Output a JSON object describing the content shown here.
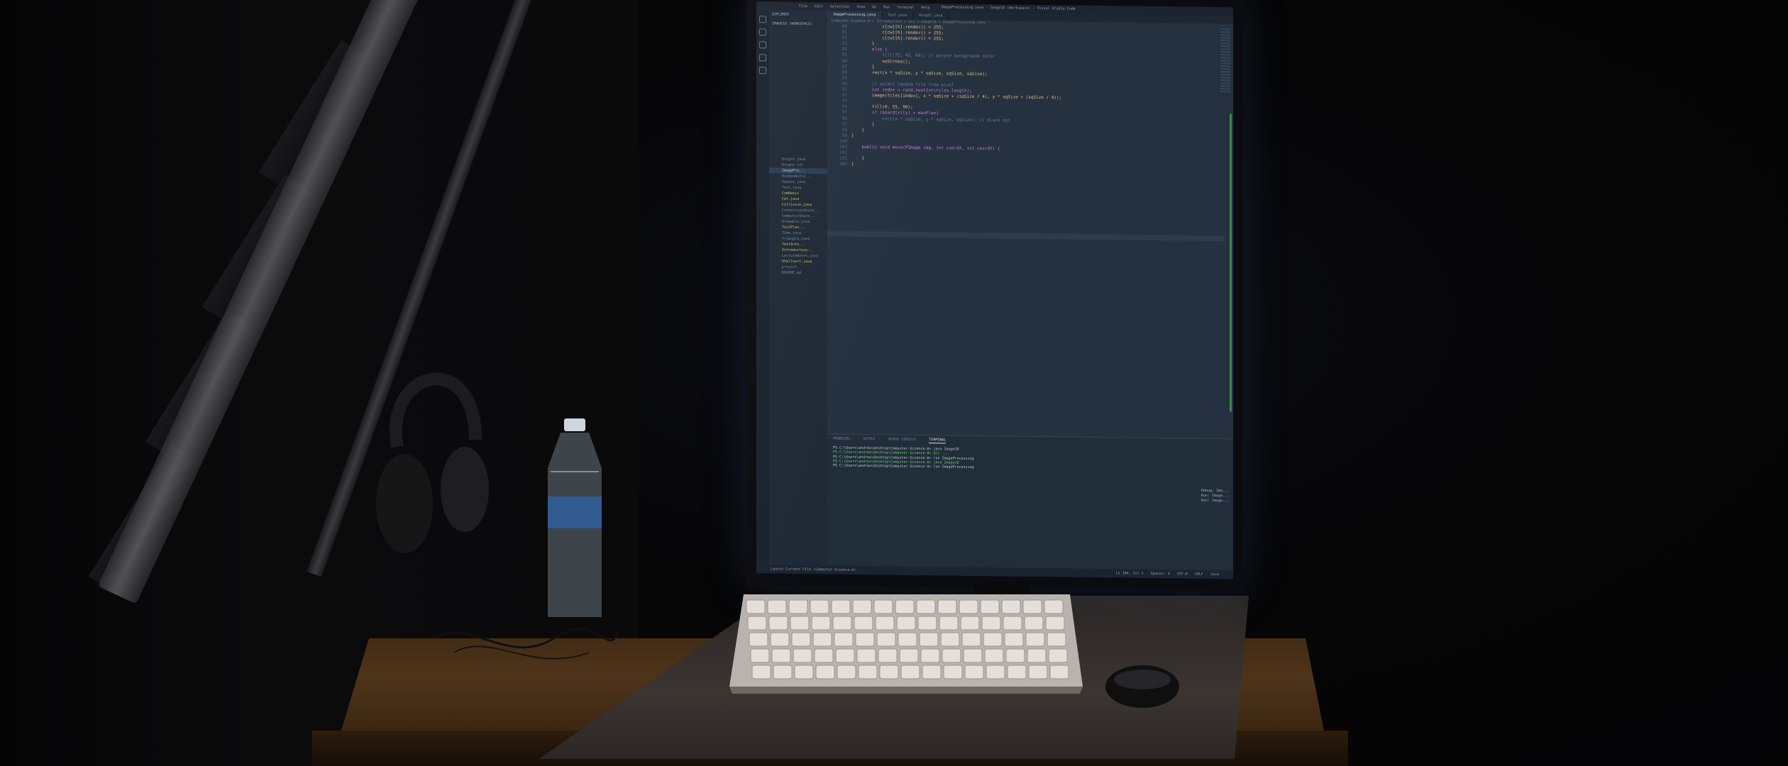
{
  "vscode": {
    "window_title": "ImageProcessing.java - Image1D (Workspace) - Visual Studio Code",
    "menu": [
      "File",
      "Edit",
      "Selection",
      "View",
      "Go",
      "Run",
      "Terminal",
      "Help"
    ],
    "tabs": [
      {
        "label": "ImageProcessing.java",
        "active": true
      },
      {
        "label": "Test.java",
        "active": false
      },
      {
        "label": "Knight.java",
        "active": false
      }
    ],
    "breadcrumb": "Computer-Science-A > Introduction > src > image1d > ImageProcessing.java",
    "sidebar_title": "EXPLORER",
    "sidebar_section": "IMAGE1D (WORKSPACE)",
    "tree": [
      {
        "label": "Knight.java",
        "hi": false,
        "sel": false
      },
      {
        "label": "Knight.txt",
        "hi": false,
        "sel": false
      },
      {
        "label": "ImagePro...",
        "hi": false,
        "sel": true
      },
      {
        "label": "HiddenWorld...",
        "hi": false,
        "sel": false
      },
      {
        "label": "Square.java",
        "hi": false,
        "sel": false
      },
      {
        "label": "Test.java",
        "hi": false,
        "sel": false
      },
      {
        "label": "ComBasic",
        "hi": true,
        "sel": false
      },
      {
        "label": "Cat.java",
        "hi": true,
        "sel": false
      },
      {
        "label": "Collision.java",
        "hi": true,
        "sel": false
      },
      {
        "label": "ConnectionShare...",
        "hi": false,
        "sel": false
      },
      {
        "label": "ComputerShare...",
        "hi": false,
        "sel": false
      },
      {
        "label": "Drawable.java",
        "hi": false,
        "sel": false
      },
      {
        "label": "TestPlan...",
        "hi": true,
        "sel": false
      },
      {
        "label": "Time.java",
        "hi": false,
        "sel": false
      },
      {
        "label": "Triangle.java",
        "hi": false,
        "sel": false
      },
      {
        "label": "TestInfo...",
        "hi": true,
        "sel": false
      },
      {
        "label": "Introduction...",
        "hi": true,
        "sel": false
      },
      {
        "label": "LectureNotes.java",
        "hi": false,
        "sel": false
      },
      {
        "label": "Shellsort.java",
        "hi": true,
        "sel": false
      },
      {
        "label": "project",
        "hi": false,
        "sel": false
      },
      {
        "label": "README.md",
        "hi": false,
        "sel": false
      }
    ],
    "line_numbers": [
      "80",
      "81",
      "82",
      "83",
      "84",
      "85",
      "86",
      "87",
      "88",
      "89",
      "90",
      "91",
      "92",
      "93",
      "94",
      "95",
      "96",
      "97",
      "98",
      "99",
      "100",
      "101",
      "102",
      "103",
      "104"
    ],
    "code_lines": [
      "            c[cw][h].render() = 255;",
      "            c[cw][h].render() = 255;",
      "            c[cw][h].render() = 255;",
      "        }",
      "        else {",
      "            fill(75, 45, 60); // purple background color",
      "            noStroke();",
      "        }",
      "        rect(x * sqSize, y * sqSize, sqSize, sqSize);",
      "",
      "        // select random tile from pixel",
      "        int index = rand.nextInt(tiles.length);",
      "        image(tiles[index], x * sqSize + (sqSize / 4), y * sqSize + (sqSize / 4));",
      "",
      "        fill(0, 55, 90);",
      "        if (board[x][y] > maxPlan)",
      "            rect(x * sqSize, y * sqSize, sqSize); // black out",
      "        }",
      "    }",
      "}",
      "",
      "    public void move(PImage img, int coordX, int coordY) {",
      "",
      "    }",
      "}"
    ],
    "panel_tabs": [
      {
        "label": "PROBLEMS",
        "active": false
      },
      {
        "label": "OUTPUT",
        "active": false
      },
      {
        "label": "DEBUG CONSOLE",
        "active": false
      },
      {
        "label": "TERMINAL",
        "active": true
      }
    ],
    "terminal_lines": [
      "PS C:\\Users\\andrew\\Desktop\\Computer-Science-A> java Image1D",
      "PS C:\\Users\\andrew\\Desktop\\Computer-Science-A> dir ...",
      "PS C:\\Users\\andrew\\Desktop\\Computer-Science-A> run ImageProcessing",
      "PS C:\\Users\\andrew\\Desktop\\Computer-Science-A> java Image1D",
      "PS C:\\Users\\andrew\\Desktop\\Computer-Science-A> run ImageProcessing"
    ],
    "terminal_sessions": [
      "Debug: Ima...",
      "Run: Image...",
      "Run: Image..."
    ],
    "status_left": "Launch Current File (Computer-Science-A)",
    "status_right": [
      "Ln 104, Col 2",
      "Spaces: 4",
      "UTF-8",
      "CRLF",
      "Java"
    ]
  }
}
